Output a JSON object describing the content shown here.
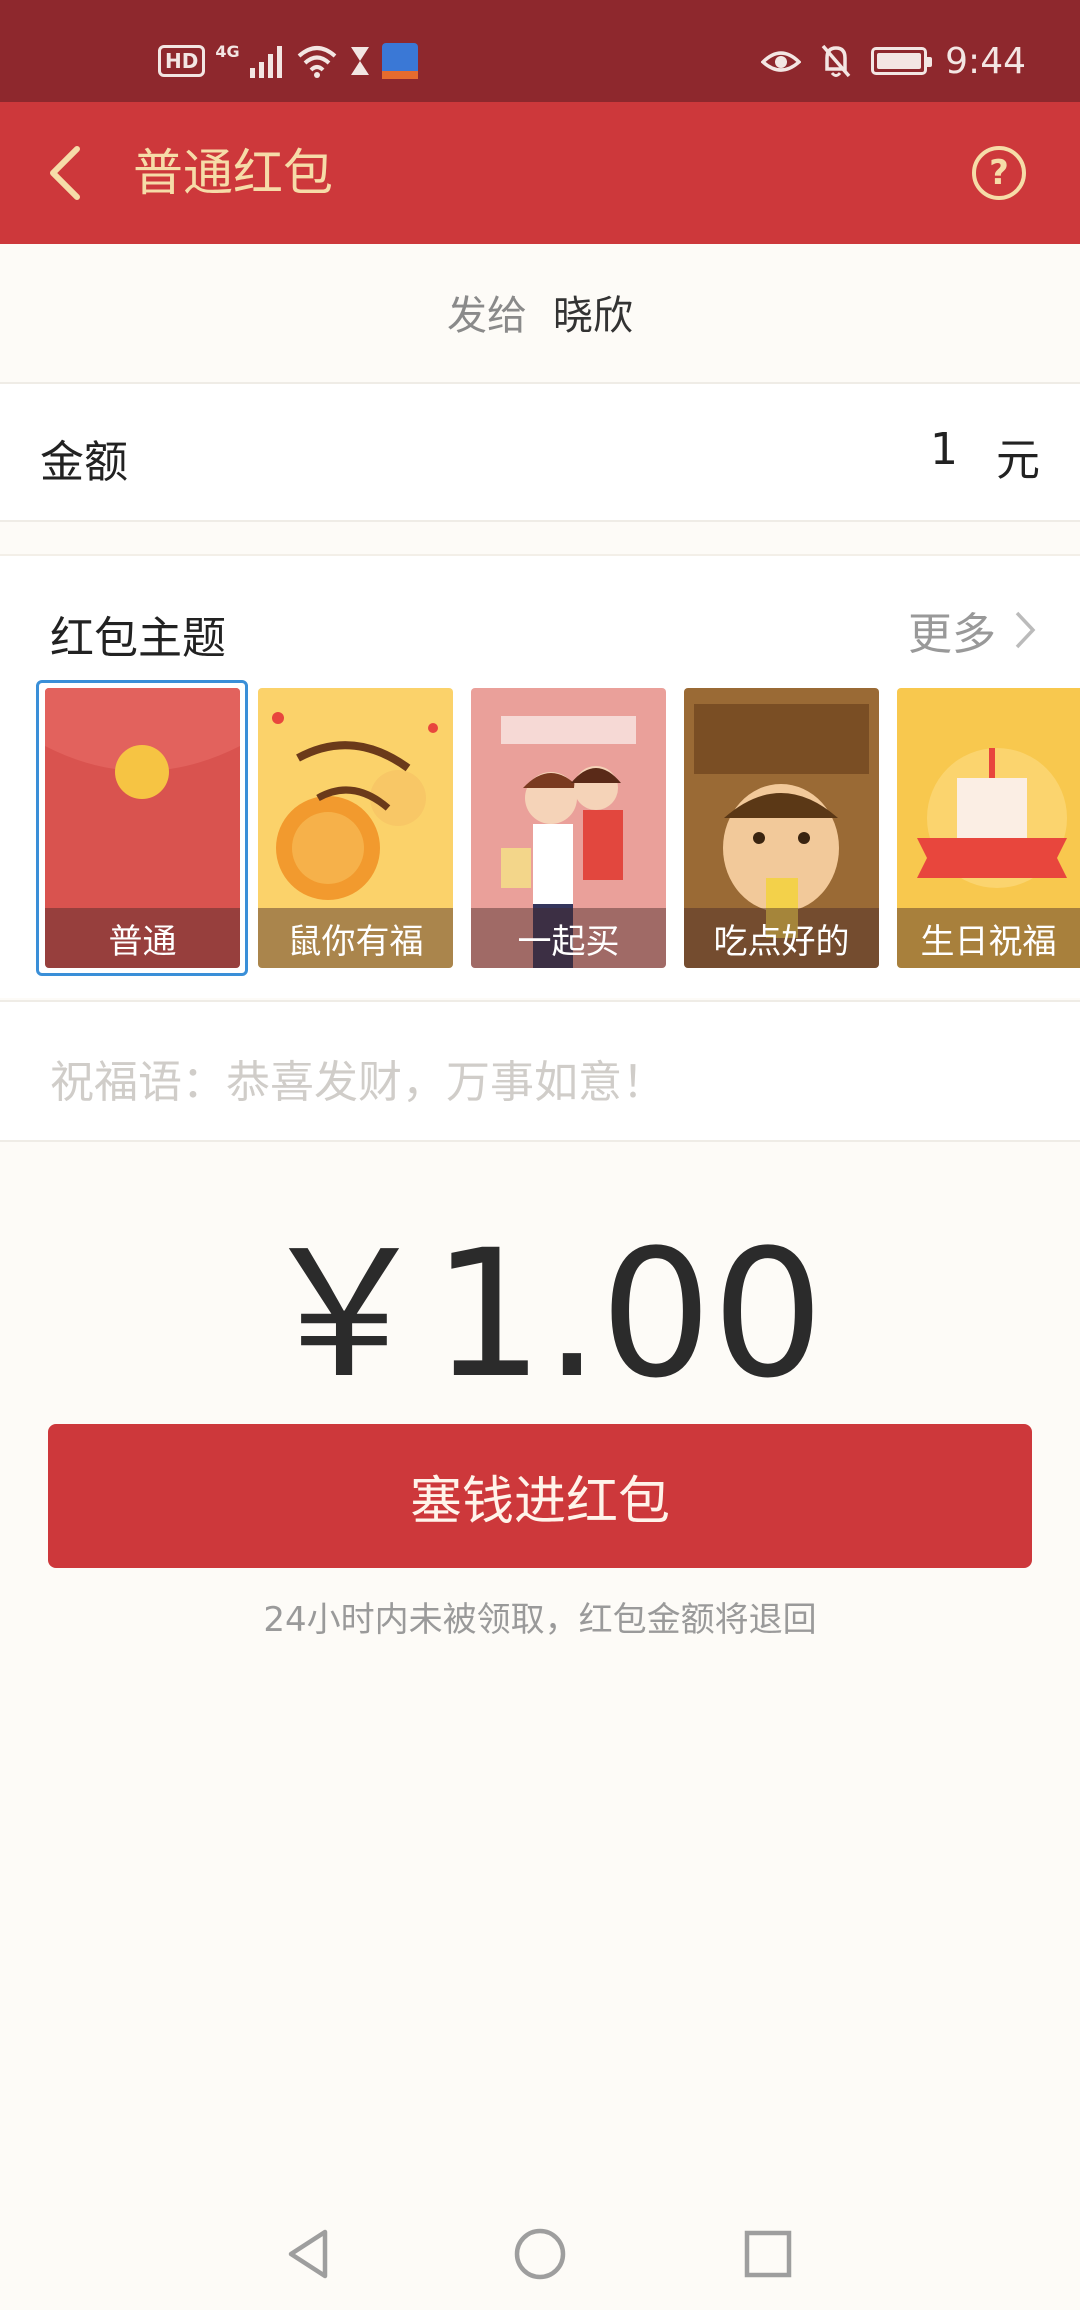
{
  "status_bar": {
    "network": "4G",
    "hd": "HD",
    "time": "9:44"
  },
  "header": {
    "title": "普通红包"
  },
  "recipient": {
    "label": "发给",
    "name": "晓欣"
  },
  "amount": {
    "label": "金额",
    "value": "1",
    "unit": "元"
  },
  "themes": {
    "title": "红包主题",
    "more_label": "更多",
    "items": [
      {
        "label": "普通",
        "color": "#d9534f"
      },
      {
        "label": "鼠你有福",
        "color": "#f7b733"
      },
      {
        "label": "一起买",
        "color": "#e98e88"
      },
      {
        "label": "吃点好的",
        "color": "#8a5a2b"
      },
      {
        "label": "生日祝福",
        "color": "#f7c948"
      }
    ],
    "selected": "普通"
  },
  "blessing": {
    "placeholder": "祝福语：恭喜发财，万事如意！"
  },
  "total_display": "￥1.00",
  "send_button_label": "塞钱进红包",
  "hint_text": "24小时内未被领取，红包金额将退回",
  "colors": {
    "status_bar": "#8e282d",
    "header": "#cd383b",
    "title_text": "#f6dca8",
    "button": "#cd383b"
  }
}
